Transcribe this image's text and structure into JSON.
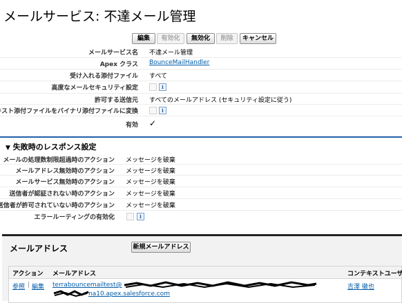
{
  "page": {
    "title": "メールサービス: 不達メール管理"
  },
  "toolbar": {
    "buttons": [
      {
        "label": "編集",
        "enabled": true
      },
      {
        "label": "有効化",
        "enabled": false
      },
      {
        "label": "無効化",
        "enabled": true
      },
      {
        "label": "削除",
        "enabled": false
      },
      {
        "label": "キャンセル",
        "enabled": true
      }
    ]
  },
  "detail": {
    "service_name_label": "メールサービス名",
    "service_name_value": "不達メール管理",
    "apex_class_label": "Apex クラス",
    "apex_class_value": "BounceMailHandler",
    "attachments_label": "受け入れる添付ファイル",
    "attachments_value": "すべて",
    "advanced_security_label": "高度なメールセキュリティ設定",
    "allowed_senders_label": "許可する送信元",
    "allowed_senders_value": "すべてのメールアドレス (セキュリティ設定に従う)",
    "convert_attachments_label": "テキスト添付ファイルをバイナリ添付ファイルに変換",
    "active_label": "有効",
    "active_value": "✓"
  },
  "failure_section": {
    "title": "失敗時のレスポンス設定",
    "rows": [
      {
        "label": "メールの処理数制限超過時のアクション",
        "value": "メッセージを破棄"
      },
      {
        "label": "メールアドレス無効時のアクション",
        "value": "メッセージを破棄"
      },
      {
        "label": "メールサービス無効時のアクション",
        "value": "メッセージを破棄"
      },
      {
        "label": "送信者が認証されない時のアクション",
        "value": "メッセージを破棄"
      },
      {
        "label": "送信者が許可されていない時のアクション",
        "value": "メッセージを破棄"
      }
    ],
    "error_routing_label": "エラールーティングの有効化"
  },
  "address_panel": {
    "title": "メールアドレス",
    "new_button": "新規メールアドレス",
    "columns": [
      "アクション",
      "メールアドレス",
      "コンテキストユーザ"
    ],
    "row": {
      "view": "参照",
      "separator": "|",
      "edit": "編集",
      "address_line1": "terrabouncemailtest@",
      "address_line2": "na10.apex.salesforce.com",
      "context_user": "吉澤 徹也"
    }
  },
  "colors": {
    "accent": "#1f5fa8",
    "link": "#015ba7"
  }
}
